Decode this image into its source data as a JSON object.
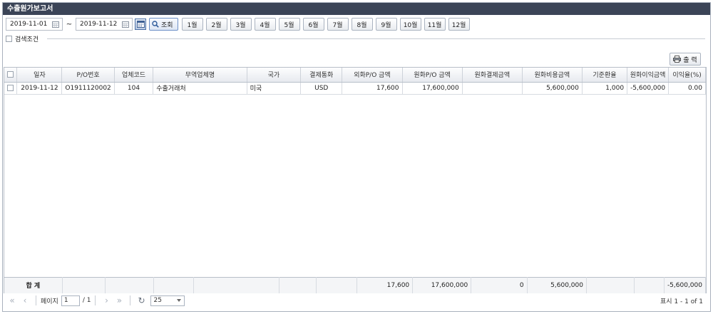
{
  "title": "수출원가보고서",
  "filters": {
    "date_from": "2019-11-01",
    "separator": "~",
    "date_to": "2019-11-12",
    "search_label": "조회",
    "months": [
      "1월",
      "2월",
      "3월",
      "4월",
      "5월",
      "6월",
      "7월",
      "8월",
      "9월",
      "10월",
      "11월",
      "12월"
    ],
    "condition_label": "검색조건"
  },
  "toolbar": {
    "print_label": "출 력"
  },
  "table": {
    "columns": [
      "일자",
      "P/O번호",
      "업체코드",
      "무역업체명",
      "국가",
      "결제통화",
      "외화P/O 금액",
      "원화P/O 금액",
      "원화결제금액",
      "원화비용금액",
      "기준환율",
      "원화이익금액",
      "이익율(%)"
    ],
    "rows": [
      [
        "2019-11-12",
        "O1911120002",
        "104",
        "수출거래처",
        "미국",
        "USD",
        "17,600",
        "17,600,000",
        "",
        "5,600,000",
        "1,000",
        "-5,600,000",
        "0.00"
      ]
    ]
  },
  "totals": {
    "label": "합 계",
    "foreign_po": "17,600",
    "krw_po": "17,600,000",
    "krw_settle": "0",
    "krw_cost": "5,600,000",
    "krw_profit": "-5,600,000"
  },
  "pager": {
    "page_label": "페이지",
    "current_page": "1",
    "total_pages": "/ 1",
    "page_size": "25",
    "info": "표시 1 - 1 of 1"
  }
}
